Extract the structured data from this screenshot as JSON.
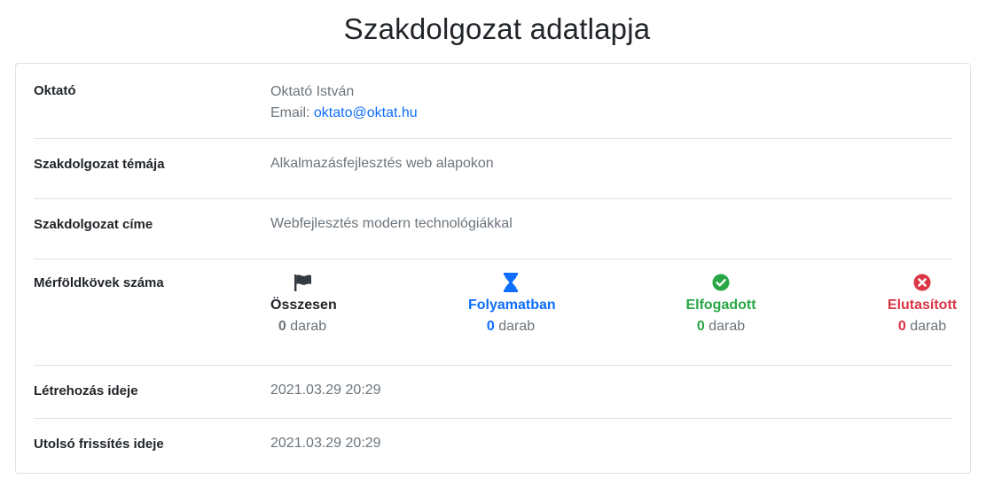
{
  "page": {
    "title": "Szakdolgozat adatlapja"
  },
  "rows": {
    "teacher": {
      "label": "Oktató",
      "name": "Oktató István",
      "email_prefix": "Email:",
      "email": "oktato@oktat.hu"
    },
    "topic": {
      "label": "Szakdolgozat témája",
      "value": "Alkalmazásfejlesztés web alapokon"
    },
    "title": {
      "label": "Szakdolgozat címe",
      "value": "Webfejlesztés modern technológiákkal"
    },
    "milestones": {
      "label": "Mérföldkövek száma",
      "unit": "darab",
      "items": [
        {
          "label": "Összesen",
          "count": "0",
          "icon": "flag-icon",
          "color": "#212529"
        },
        {
          "label": "Folyamatban",
          "count": "0",
          "icon": "hourglass-icon",
          "color": "#0d6efd"
        },
        {
          "label": "Elfogadott",
          "count": "0",
          "icon": "check-circle-icon",
          "color": "#28a745"
        },
        {
          "label": "Elutasított",
          "count": "0",
          "icon": "times-circle-icon",
          "color": "#dc3545"
        }
      ]
    },
    "created": {
      "label": "Létrehozás ideje",
      "value": "2021.03.29 20:29"
    },
    "updated": {
      "label": "Utolsó frissítés ideje",
      "value": "2021.03.29 20:29"
    }
  }
}
